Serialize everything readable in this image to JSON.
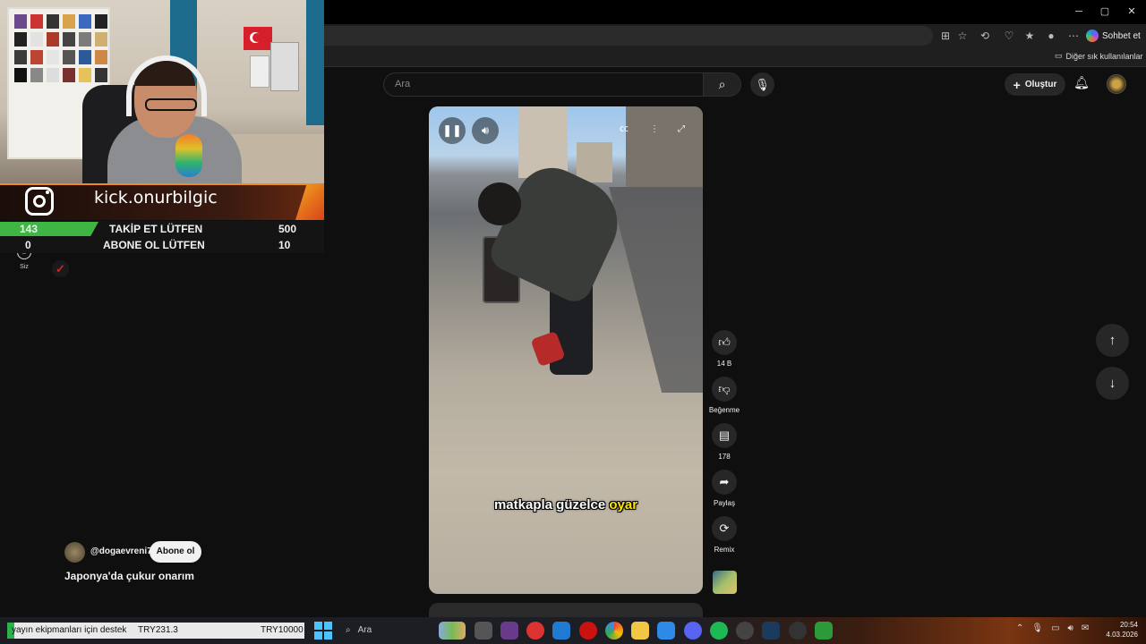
{
  "browser": {
    "copilot_label": "Sohbet et",
    "bookmark_folder": "Diğer sık kullanılanlar",
    "win_minimize": "─",
    "win_maximize": "▢",
    "win_close": "✕"
  },
  "header": {
    "search_placeholder": "Ara",
    "create_label": "Oluştur"
  },
  "video": {
    "caption_main": "matkapla güzelce",
    "caption_highlight": "oyar"
  },
  "actions": {
    "like_count": "14 B",
    "dislike_label": "Beğenme",
    "comment_count": "178",
    "share_label": "Paylaş",
    "remix_label": "Remix"
  },
  "channel": {
    "handle": "@dogaevreni7",
    "subscribe_label": "Abone ol",
    "video_title": "Japonya'da çukur onarım"
  },
  "sidebar": {
    "you_label": "Siz"
  },
  "stream_overlay": {
    "kick_handle": "kick.onurbilgic",
    "goals": [
      {
        "current": "143",
        "label": "TAKİP ET LÜTFEN",
        "target": "500",
        "progress": 0.286
      },
      {
        "current": "0",
        "label": "ABONE OL LÜTFEN",
        "target": "10",
        "progress": 0.0
      }
    ]
  },
  "taskbar": {
    "donation_label": "yayın ekipmanları için destek",
    "donation_current": "TRY231.3",
    "donation_target": "TRY10000",
    "donation_progress": 0.023,
    "search_label": "Ara",
    "time": "20:54",
    "date": "4.03.2026"
  },
  "colors": {
    "accent_green": "#3fb543",
    "caption_yellow": "#ffe600",
    "kick_orange": "#f08a24"
  }
}
